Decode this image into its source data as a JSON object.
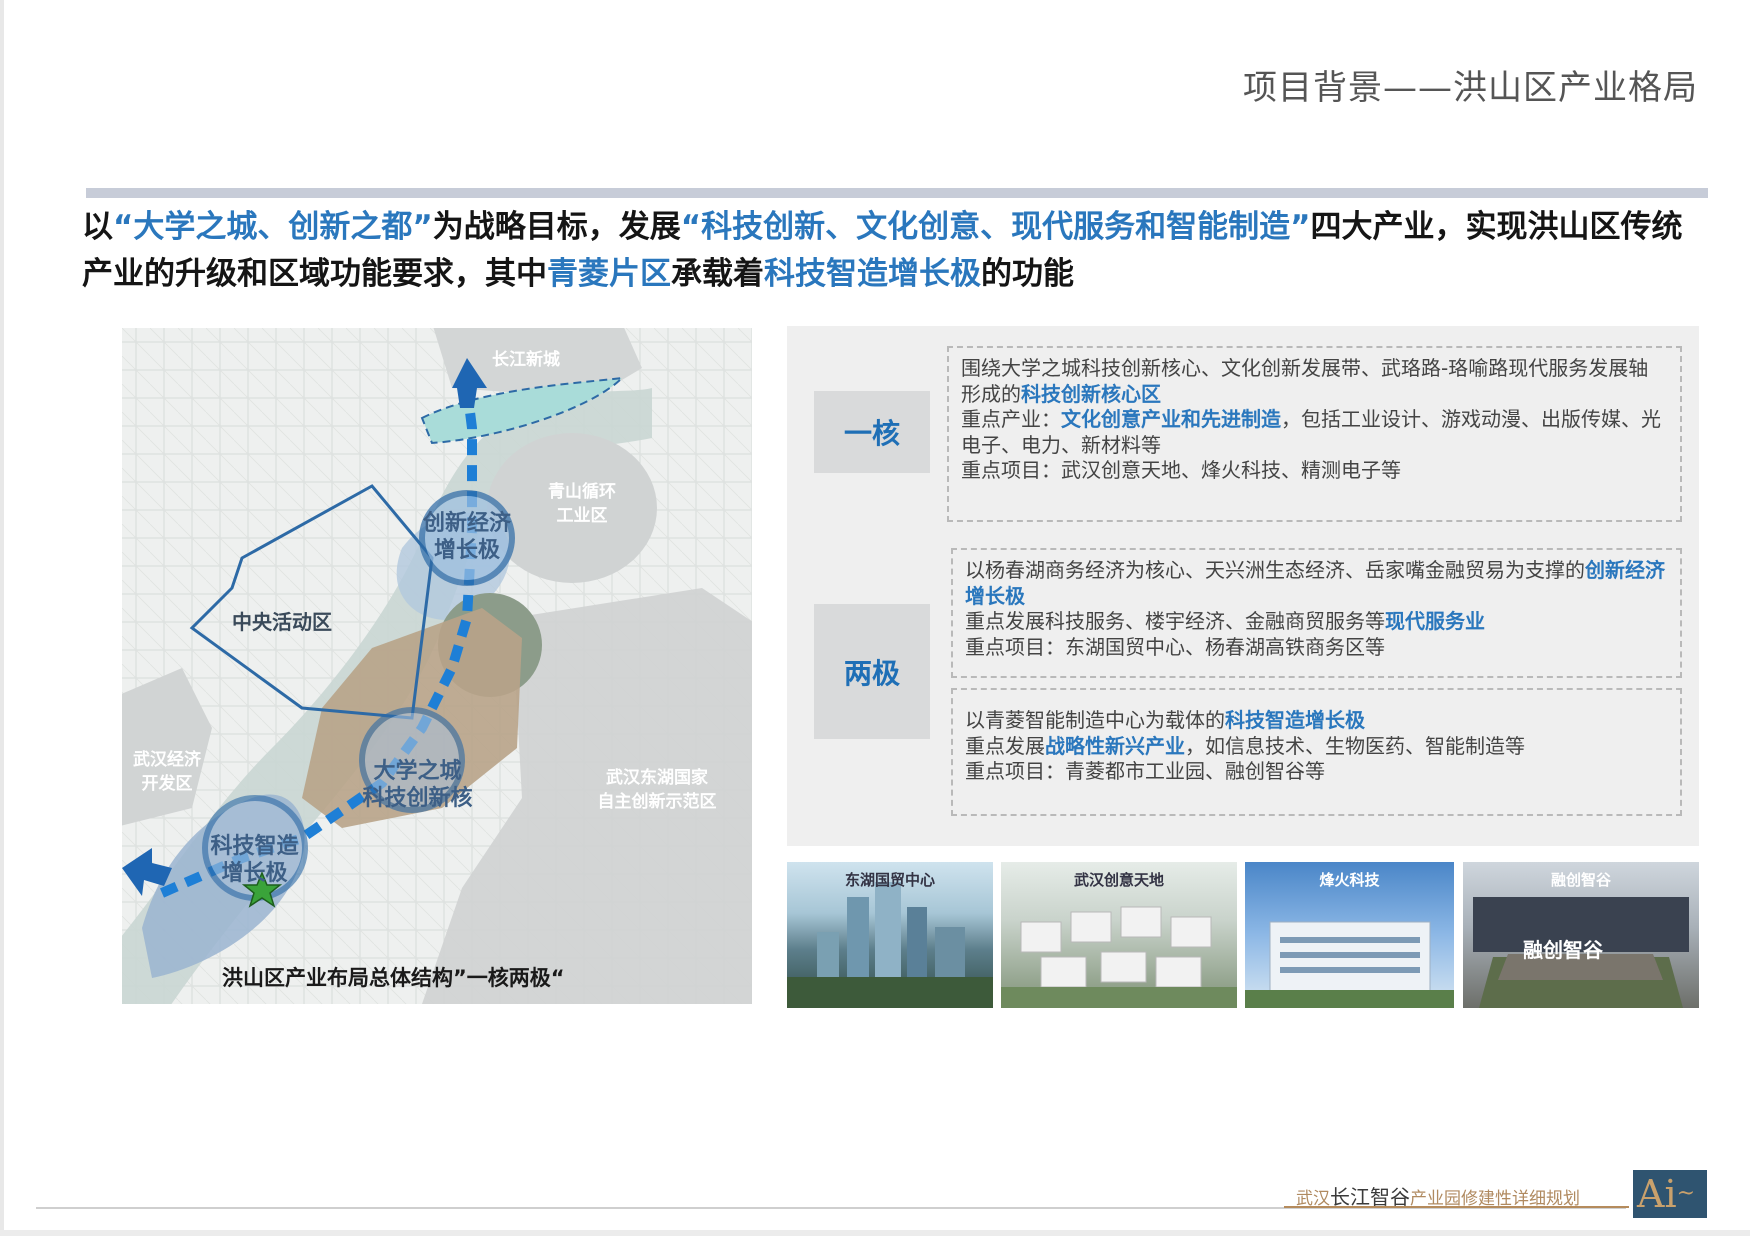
{
  "page": {
    "title": "项目背景——洪山区产业格局"
  },
  "headline": {
    "p1": "以",
    "q1": "“大学之城、创新之都”",
    "p2": "为战略目标，发展",
    "q2": "“科技创新、文化创意、现代服务和智能制造”",
    "p3": "四大产业，实现洪山区传统产业的升级和区域功能要求，其中",
    "q3": "青菱片区",
    "p4": "承载着",
    "q4": "科技智造增长极",
    "p5": "的功能"
  },
  "map": {
    "labels": {
      "changjiang_new_city": "长江新城",
      "qingshan": "青山循环\n工业区",
      "central": "中央活动区",
      "wuhan_econ": "武汉经济\n开发区",
      "donghu": "武汉东湖国家\n自主创新示范区",
      "node_innovation": "创新经济\n增长极",
      "node_university": "大学之城\n科技创新核",
      "node_smart": "科技智造\n增长极"
    },
    "caption": "洪山区产业布局总体结构”一核两极“"
  },
  "panel": {
    "core": {
      "tag": "一核",
      "line1a": "围绕大学之城科技创新核心、文化创新发展带、武珞路-珞喻路现代服务发展轴形成的",
      "line1b": "科技创新核心区",
      "line2a": "重点产业：",
      "line2b": "文化创意产业和先进制造",
      "line2c": "，包括工业设计、游戏动漫、出版传媒、光电子、电力、新材料等",
      "line3": "重点项目：武汉创意天地、烽火科技、精测电子等"
    },
    "poles": {
      "tag": "两极",
      "a": {
        "line1a": "以杨春湖商务经济为核心、天兴洲生态经济、岳家嘴金融贸易为支撑的",
        "line1b": "创新经济增长极",
        "line2a": "重点发展科技服务、楼宇经济、金融商贸服务等",
        "line2b": "现代服务业",
        "line3": "重点项目：东湖国贸中心、杨春湖高铁商务区等"
      },
      "b": {
        "line1a": "以青菱智能制造中心为载体的",
        "line1b": "科技智造增长极",
        "line2a": "重点发展",
        "line2b": "战略性新兴产业",
        "line2c": "，如信息技术、生物医药、智能制造等",
        "line3": "重点项目：青菱都市工业园、融创智谷等"
      }
    }
  },
  "photos": [
    {
      "label": "东湖国贸中心"
    },
    {
      "label": "武汉创意天地"
    },
    {
      "label": "烽火科技"
    },
    {
      "label": "融创智谷"
    }
  ],
  "photo_signage": "融创智谷",
  "footer": {
    "p1": "武汉",
    "p2": "长江智谷",
    "p3": "产业园修建性详细规划"
  },
  "logo": {
    "text": "Ai"
  },
  "colors": {
    "accent": "#2a77bd",
    "panel_bg": "#efefef",
    "tag_bg": "#d9dadb",
    "footer_gold": "#b58b5c"
  }
}
